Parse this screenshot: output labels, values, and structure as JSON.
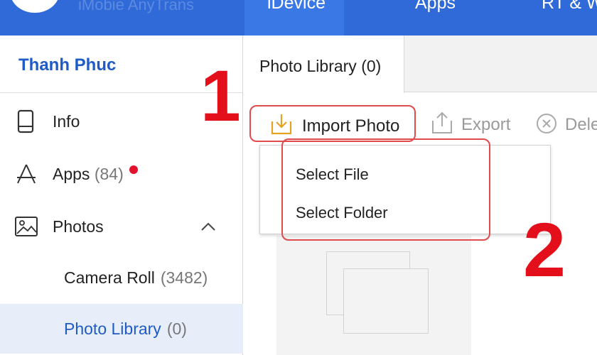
{
  "nav": {
    "app_title": "iMobie AnyTrans",
    "tabs": [
      {
        "label": "iDevice",
        "active": true
      },
      {
        "label": "Apps",
        "active": false
      },
      {
        "label": "RT & W",
        "active": false
      }
    ]
  },
  "sidebar": {
    "user_name": "Thanh Phuc",
    "items": [
      {
        "label": "Info",
        "icon": "phone-icon"
      },
      {
        "label": "Apps",
        "count": "(84)",
        "icon": "app-store-icon",
        "badge": true
      },
      {
        "label": "Photos",
        "icon": "image-icon",
        "expanded": true
      }
    ],
    "subitems": [
      {
        "label": "Camera Roll",
        "count": "(3482)",
        "selected": false
      },
      {
        "label": "Photo Library",
        "count": "(0)",
        "selected": true
      }
    ]
  },
  "main": {
    "tab_label": "Photo Library (0)",
    "toolbar": {
      "import_label": "Import Photo",
      "export_label": "Export",
      "delete_label": "Dele"
    },
    "dropdown": {
      "items": [
        "Select File",
        "Select Folder"
      ]
    }
  },
  "annotations": {
    "step1": "1",
    "step2": "2"
  },
  "colors": {
    "topbar": "#2f6ad8",
    "active_tab": "#3a78e6",
    "accent_text": "#1e5bc6",
    "highlight_border": "#e04b4b",
    "annotation_red": "#e3101c",
    "badge_red": "#e3122c",
    "import_icon": "#e6a221"
  }
}
